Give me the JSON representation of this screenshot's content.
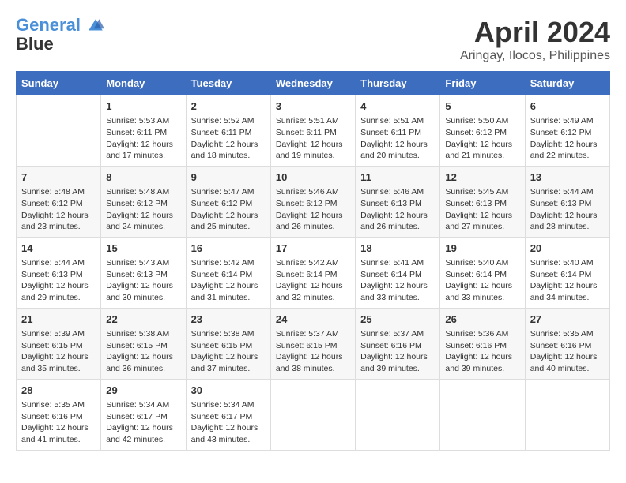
{
  "header": {
    "logo_line1": "General",
    "logo_line2": "Blue",
    "month": "April 2024",
    "location": "Aringay, Ilocos, Philippines"
  },
  "columns": [
    "Sunday",
    "Monday",
    "Tuesday",
    "Wednesday",
    "Thursday",
    "Friday",
    "Saturday"
  ],
  "weeks": [
    [
      {
        "day": "",
        "info": ""
      },
      {
        "day": "1",
        "info": "Sunrise: 5:53 AM\nSunset: 6:11 PM\nDaylight: 12 hours\nand 17 minutes."
      },
      {
        "day": "2",
        "info": "Sunrise: 5:52 AM\nSunset: 6:11 PM\nDaylight: 12 hours\nand 18 minutes."
      },
      {
        "day": "3",
        "info": "Sunrise: 5:51 AM\nSunset: 6:11 PM\nDaylight: 12 hours\nand 19 minutes."
      },
      {
        "day": "4",
        "info": "Sunrise: 5:51 AM\nSunset: 6:11 PM\nDaylight: 12 hours\nand 20 minutes."
      },
      {
        "day": "5",
        "info": "Sunrise: 5:50 AM\nSunset: 6:12 PM\nDaylight: 12 hours\nand 21 minutes."
      },
      {
        "day": "6",
        "info": "Sunrise: 5:49 AM\nSunset: 6:12 PM\nDaylight: 12 hours\nand 22 minutes."
      }
    ],
    [
      {
        "day": "7",
        "info": "Sunrise: 5:48 AM\nSunset: 6:12 PM\nDaylight: 12 hours\nand 23 minutes."
      },
      {
        "day": "8",
        "info": "Sunrise: 5:48 AM\nSunset: 6:12 PM\nDaylight: 12 hours\nand 24 minutes."
      },
      {
        "day": "9",
        "info": "Sunrise: 5:47 AM\nSunset: 6:12 PM\nDaylight: 12 hours\nand 25 minutes."
      },
      {
        "day": "10",
        "info": "Sunrise: 5:46 AM\nSunset: 6:12 PM\nDaylight: 12 hours\nand 26 minutes."
      },
      {
        "day": "11",
        "info": "Sunrise: 5:46 AM\nSunset: 6:13 PM\nDaylight: 12 hours\nand 26 minutes."
      },
      {
        "day": "12",
        "info": "Sunrise: 5:45 AM\nSunset: 6:13 PM\nDaylight: 12 hours\nand 27 minutes."
      },
      {
        "day": "13",
        "info": "Sunrise: 5:44 AM\nSunset: 6:13 PM\nDaylight: 12 hours\nand 28 minutes."
      }
    ],
    [
      {
        "day": "14",
        "info": "Sunrise: 5:44 AM\nSunset: 6:13 PM\nDaylight: 12 hours\nand 29 minutes."
      },
      {
        "day": "15",
        "info": "Sunrise: 5:43 AM\nSunset: 6:13 PM\nDaylight: 12 hours\nand 30 minutes."
      },
      {
        "day": "16",
        "info": "Sunrise: 5:42 AM\nSunset: 6:14 PM\nDaylight: 12 hours\nand 31 minutes."
      },
      {
        "day": "17",
        "info": "Sunrise: 5:42 AM\nSunset: 6:14 PM\nDaylight: 12 hours\nand 32 minutes."
      },
      {
        "day": "18",
        "info": "Sunrise: 5:41 AM\nSunset: 6:14 PM\nDaylight: 12 hours\nand 33 minutes."
      },
      {
        "day": "19",
        "info": "Sunrise: 5:40 AM\nSunset: 6:14 PM\nDaylight: 12 hours\nand 33 minutes."
      },
      {
        "day": "20",
        "info": "Sunrise: 5:40 AM\nSunset: 6:14 PM\nDaylight: 12 hours\nand 34 minutes."
      }
    ],
    [
      {
        "day": "21",
        "info": "Sunrise: 5:39 AM\nSunset: 6:15 PM\nDaylight: 12 hours\nand 35 minutes."
      },
      {
        "day": "22",
        "info": "Sunrise: 5:38 AM\nSunset: 6:15 PM\nDaylight: 12 hours\nand 36 minutes."
      },
      {
        "day": "23",
        "info": "Sunrise: 5:38 AM\nSunset: 6:15 PM\nDaylight: 12 hours\nand 37 minutes."
      },
      {
        "day": "24",
        "info": "Sunrise: 5:37 AM\nSunset: 6:15 PM\nDaylight: 12 hours\nand 38 minutes."
      },
      {
        "day": "25",
        "info": "Sunrise: 5:37 AM\nSunset: 6:16 PM\nDaylight: 12 hours\nand 39 minutes."
      },
      {
        "day": "26",
        "info": "Sunrise: 5:36 AM\nSunset: 6:16 PM\nDaylight: 12 hours\nand 39 minutes."
      },
      {
        "day": "27",
        "info": "Sunrise: 5:35 AM\nSunset: 6:16 PM\nDaylight: 12 hours\nand 40 minutes."
      }
    ],
    [
      {
        "day": "28",
        "info": "Sunrise: 5:35 AM\nSunset: 6:16 PM\nDaylight: 12 hours\nand 41 minutes."
      },
      {
        "day": "29",
        "info": "Sunrise: 5:34 AM\nSunset: 6:17 PM\nDaylight: 12 hours\nand 42 minutes."
      },
      {
        "day": "30",
        "info": "Sunrise: 5:34 AM\nSunset: 6:17 PM\nDaylight: 12 hours\nand 43 minutes."
      },
      {
        "day": "",
        "info": ""
      },
      {
        "day": "",
        "info": ""
      },
      {
        "day": "",
        "info": ""
      },
      {
        "day": "",
        "info": ""
      }
    ]
  ]
}
